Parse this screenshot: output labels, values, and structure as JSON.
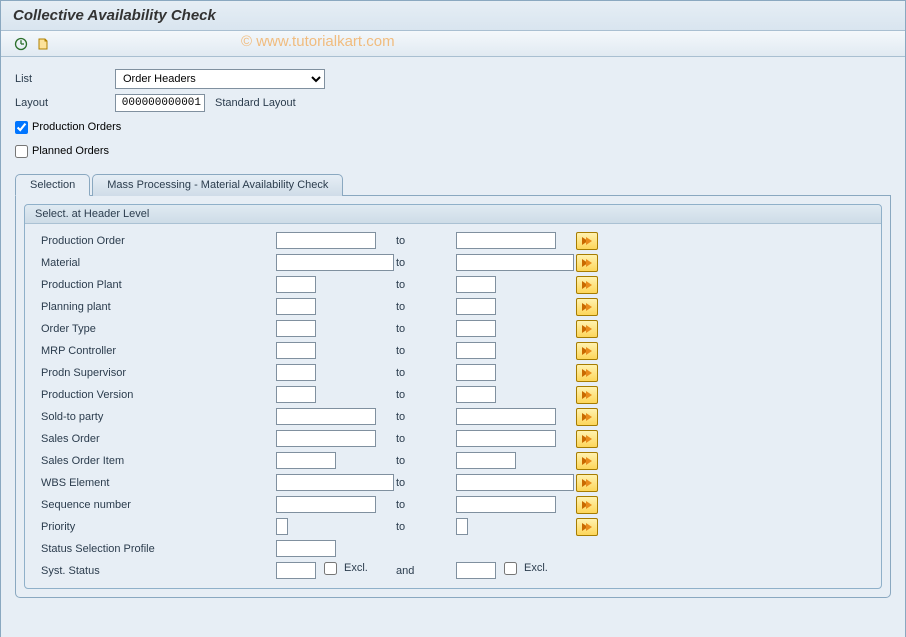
{
  "title": "Collective Availability Check",
  "watermark": "© www.tutorialkart.com",
  "top": {
    "list_label": "List",
    "list_value": "Order Headers",
    "layout_label": "Layout",
    "layout_value": "000000000001",
    "layout_desc": "Standard Layout",
    "chk_prod_label": "Production Orders",
    "chk_prod_checked": true,
    "chk_plan_label": "Planned Orders",
    "chk_plan_checked": false
  },
  "tabs": {
    "t1": "Selection",
    "t2": "Mass Processing - Material Availability Check"
  },
  "group_title": "Select. at Header Level",
  "to_text": "to",
  "and_text": "and",
  "excl_text": "Excl.",
  "rows": [
    {
      "label": "Production Order",
      "w": "fw-100"
    },
    {
      "label": "Material",
      "w": "fw-100",
      "wide": true
    },
    {
      "label": "Production Plant",
      "w": "fw-40"
    },
    {
      "label": "Planning plant",
      "w": "fw-40"
    },
    {
      "label": "Order Type",
      "w": "fw-40"
    },
    {
      "label": "MRP Controller",
      "w": "fw-40"
    },
    {
      "label": "Prodn Supervisor",
      "w": "fw-40"
    },
    {
      "label": "Production Version",
      "w": "fw-40"
    },
    {
      "label": "Sold-to party",
      "w": "fw-100"
    },
    {
      "label": "Sales Order",
      "w": "fw-100"
    },
    {
      "label": "Sales Order Item",
      "w": "fw-60"
    },
    {
      "label": "WBS Element",
      "w": "fw-100",
      "wide": true
    },
    {
      "label": "Sequence number",
      "w": "fw-100"
    },
    {
      "label": "Priority",
      "w": "fw-12"
    }
  ],
  "extra": {
    "status_profile": "Status Selection Profile",
    "syst_status": "Syst. Status"
  }
}
